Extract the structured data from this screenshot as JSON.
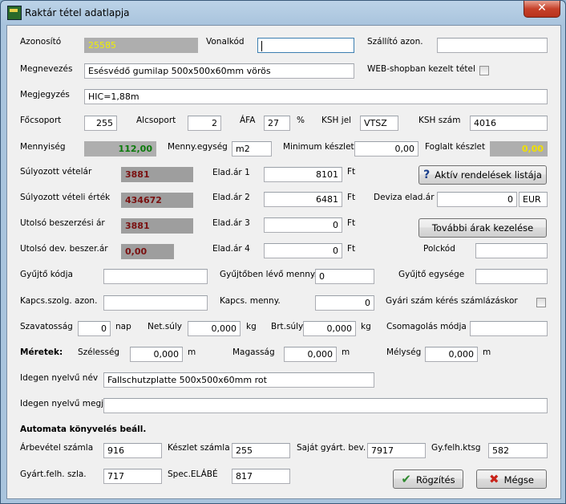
{
  "window": {
    "title": "Raktár tétel adatlapja",
    "close": "✕"
  },
  "labels": {
    "azonosito": "Azonosító",
    "vonalkod": "Vonalkód",
    "szallito_azon": "Szállító azon.",
    "megnevezes": "Megnevezés",
    "webshop": "WEB-shopban kezelt tétel",
    "megjegyzes": "Megjegyzés",
    "focsoport": "Főcsoport",
    "alcsoport": "Alcsoport",
    "afa": "ÁFA",
    "afa_unit": "%",
    "ksh_jel": "KSH jel",
    "ksh_szam": "KSH szám",
    "mennyiseg": "Mennyiség",
    "menny_egyseg": "Menny.egység",
    "min_keszlet": "Minimum készlet",
    "foglalt_keszlet": "Foglalt készlet",
    "sulyozott_vetelar": "Súlyozott vételár",
    "sulyozott_veteli_ertek": "Súlyozott vételi érték",
    "utolso_beszerzesi_ar": "Utolsó beszerzési ár",
    "utolso_dev_beszer_ar": "Utolsó dev. beszer.ár",
    "elad_ar_1": "Elad.ár 1",
    "elad_ar_2": "Elad.ár 2",
    "elad_ar_3": "Elad.ár 3",
    "elad_ar_4": "Elad.ár 4",
    "ft": "Ft",
    "deviza_elad_ar": "Deviza elad.ár",
    "polckod": "Polckód",
    "gyujto_kodja": "Gyűjtő kódja",
    "gyujtoben_levo_menny": "Gyűjtőben lévő menny.",
    "gyujto_egysege": "Gyűjtő egysége",
    "kapcs_szolg_azon": "Kapcs.szolg. azon.",
    "kapcs_menny": "Kapcs. menny.",
    "gyari_szam": "Gyári szám kérés számlázáskor",
    "szavatossag": "Szavatosság",
    "nap": "nap",
    "net_suly": "Net.súly",
    "kg": "kg",
    "brt_suly": "Brt.súly",
    "csomagolas_modja": "Csomagolás módja",
    "meretek": "Méretek:",
    "szelesseg": "Szélesség",
    "m": "m",
    "magassag": "Magasság",
    "melyseg": "Mélység",
    "idegen_nyelvu_nev": "Idegen nyelvű név",
    "idegen_nyelvu_megj": "Idegen nyelvű megj.",
    "automata": "Automata könyvelés beáll.",
    "arbevetel_szamla": "Árbevétel számla",
    "keszlet_szamla": "Készlet számla",
    "sajat_gyart_bev": "Saját gyárt. bev.",
    "gy_felh_ktsg": "Gy.felh.ktsg",
    "gyart_felh_szla": "Gyárt.felh. szla.",
    "spec_elabe": "Spec.ELÁBÉ"
  },
  "values": {
    "azonosito": "25585",
    "vonalkod": "",
    "szallito_azon": "",
    "megnevezes": "Esésvédő gumilap 500x500x60mm vörös",
    "megjegyzes": "HIC=1,88m",
    "focsoport": "255",
    "alcsoport": "2",
    "afa": "27",
    "ksh_jel": "VTSZ",
    "ksh_szam": "4016",
    "mennyiseg": "112,00",
    "menny_egyseg": "m2",
    "min_keszlet": "0,00",
    "foglalt_keszlet": "0,00",
    "sulyozott_vetelar": "3881",
    "sulyozott_veteli_ertek": "434672",
    "utolso_beszerzesi_ar": "3881",
    "utolso_dev_beszer_ar": "0,00",
    "elad_ar_1": "8101",
    "elad_ar_2": "6481",
    "elad_ar_3": "0",
    "elad_ar_4": "0",
    "deviza_elad_ar": "0",
    "deviza": "EUR",
    "polckod": "",
    "gyujto_kodja": "",
    "gyujtoben_levo_menny": "0",
    "gyujto_egysege": "",
    "kapcs_szolg_azon": "",
    "kapcs_menny": "0",
    "szavatossag": "0",
    "net_suly": "0,000",
    "brt_suly": "0,000",
    "csomagolas_modja": "",
    "szelesseg": "0,000",
    "magassag": "0,000",
    "melyseg": "0,000",
    "idegen_nyelvu_nev": "Fallschutzplatte 500x500x60mm rot",
    "idegen_nyelvu_megj": "",
    "arbevetel_szamla": "916",
    "keszlet_szamla": "255",
    "sajat_gyart_bev": "7917",
    "gy_felh_ktsg": "582",
    "gyart_felh_szla": "717",
    "spec_elabe": "817"
  },
  "buttons": {
    "aktiv_rendelesek": "Aktív rendelések listája",
    "tovabbi_arak": "További árak kezelése",
    "rogzites": "Rögzítés",
    "megse": "Mégse"
  },
  "icons": {
    "aktiv": "question-icon",
    "rogzites": "checkmark-icon",
    "megse": "cross-icon"
  }
}
